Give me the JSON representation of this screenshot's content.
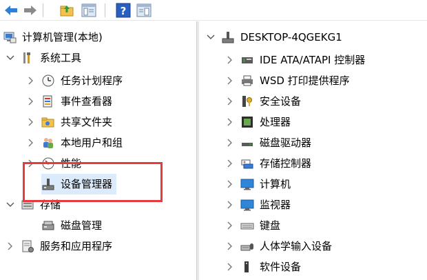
{
  "left_tree": {
    "root": "计算机管理(本地)",
    "system_tools": "系统工具",
    "task_scheduler": "任务计划程序",
    "event_viewer": "事件查看器",
    "shared_folders": "共享文件夹",
    "local_users": "本地用户和组",
    "performance": "性能",
    "device_manager": "设备管理器",
    "storage": "存储",
    "disk_management": "磁盘管理",
    "services_apps": "服务和应用程序"
  },
  "right_tree": {
    "computer": "DESKTOP-4QGEKG1",
    "items": [
      "IDE ATA/ATAPI 控制器",
      "WSD 打印提供程序",
      "安全设备",
      "处理器",
      "磁盘驱动器",
      "存储控制器",
      "计算机",
      "监视器",
      "键盘",
      "人体学输入设备",
      "软件设备"
    ]
  },
  "colors": {
    "highlight": "#e8393f",
    "selection": "#dcebfc",
    "arrow_blue": "#1f6fd1"
  }
}
